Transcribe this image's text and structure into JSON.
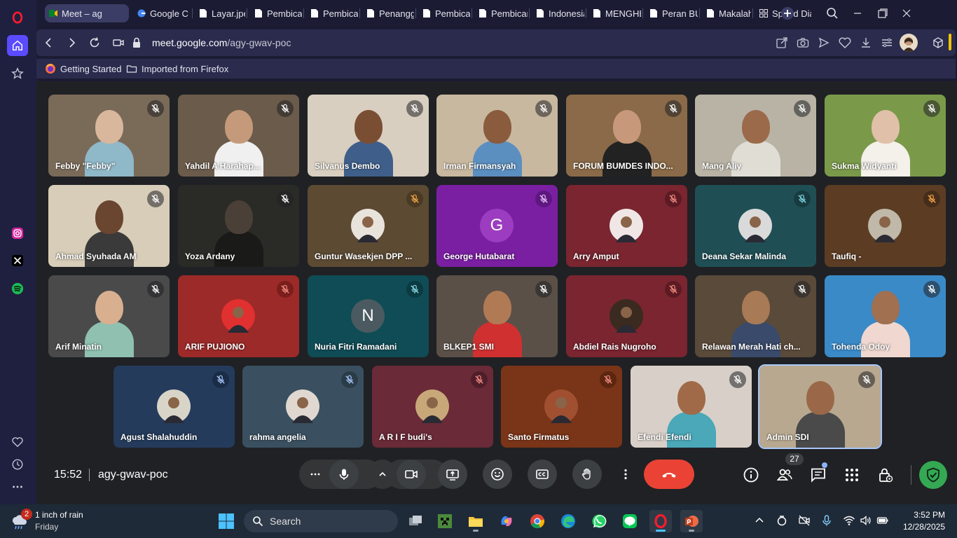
{
  "browser": {
    "tabs": [
      {
        "label": "Meet – ag",
        "active": true
      },
      {
        "label": "Google C"
      },
      {
        "label": "Layar.jpeg"
      },
      {
        "label": "Pembicara"
      },
      {
        "label": "Pembicara"
      },
      {
        "label": "Penangga"
      },
      {
        "label": "Pembicar"
      },
      {
        "label": "Pembicar"
      },
      {
        "label": "Indonesia"
      },
      {
        "label": "MENGHE"
      },
      {
        "label": "Peran BU"
      },
      {
        "label": "Makalah"
      },
      {
        "label": "Speed Dia"
      }
    ],
    "url_host": "meet.google.com",
    "url_path": "/agy-gwav-poc",
    "bookmarks": [
      "Getting Started",
      "Imported from Firefox"
    ]
  },
  "meet": {
    "participants": [
      {
        "name": "Febby \"Febby\"",
        "kind": "video",
        "bg": "#7a6a58",
        "skin": "#d8b79c",
        "shirt": "#8fb8c8"
      },
      {
        "name": "Yahdil A Harahap...",
        "kind": "video",
        "bg": "#6b5b4b",
        "skin": "#c59a7a",
        "shirt": "#f0f0f0"
      },
      {
        "name": "Silvanus Dembo",
        "kind": "video",
        "bg": "#d9cfc0",
        "skin": "#7a4e33",
        "shirt": "#3f5f8a"
      },
      {
        "name": "Irman Firmansyah",
        "kind": "video",
        "bg": "#c8b8a0",
        "skin": "#8a5b3c",
        "shirt": "#5b8fc0"
      },
      {
        "name": "FORUM BUMDES INDO...",
        "kind": "video",
        "bg": "#8a6a48",
        "skin": "#c8987a",
        "shirt": "#222222"
      },
      {
        "name": "Mang Aliy",
        "kind": "video",
        "bg": "#b9b3a5",
        "skin": "#9a6a4a",
        "shirt": "#e0ddd5"
      },
      {
        "name": "Sukma Widyanti",
        "kind": "video",
        "bg": "#7a9a4a",
        "skin": "#e0c0a8",
        "shirt": "#f4f0ea"
      },
      {
        "name": "Ahmad Syuhada AM",
        "kind": "video",
        "bg": "#d8cdb8",
        "skin": "#6a4530",
        "shirt": "#3a3a3a"
      },
      {
        "name": "Yoza Ardany",
        "kind": "video",
        "bg": "#2a2a26",
        "skin": "#4a4038",
        "shirt": "#1a1a18"
      },
      {
        "name": "Guntur Wasekjen DPP ...",
        "kind": "avatar",
        "bg": "#5c4a33",
        "avatar_bg": "#e8e4dc",
        "mic_bg": "#4a3a24",
        "mic_color": "#f2a546"
      },
      {
        "name": "George Hutabarat",
        "kind": "letter",
        "letter": "G",
        "bg": "#7b1fa2",
        "avatar_bg": "#9c3cc0",
        "mic_bg": "#5e1780",
        "mic_color": "#e6c0f5"
      },
      {
        "name": "Arry Amput",
        "kind": "avatar",
        "bg": "#7a2530",
        "avatar_bg": "#f0e6e6",
        "mic_bg": "#5c1a22",
        "mic_color": "#f28b82"
      },
      {
        "name": "Deana Sekar Malinda",
        "kind": "avatar",
        "bg": "#1f4f55",
        "avatar_bg": "#dadada",
        "mic_bg": "#173b40",
        "mic_color": "#7fd8e0"
      },
      {
        "name": "Taufiq -",
        "kind": "avatar",
        "bg": "#5c3d24",
        "avatar_bg": "#c0b8a8",
        "mic_bg": "#452d1a",
        "mic_color": "#f2a546"
      },
      {
        "name": "Arif Minatin",
        "kind": "video",
        "bg": "#4a4a4a",
        "skin": "#d8b090",
        "shirt": "#8fc0b0"
      },
      {
        "name": "ARIF PUJIONO",
        "kind": "avatar",
        "bg": "#9c2a28",
        "avatar_bg": "#e03030",
        "mic_bg": "#7a1e1c",
        "mic_color": "#f28b82"
      },
      {
        "name": "Nuria Fitri Ramadani",
        "kind": "letter",
        "letter": "N",
        "bg": "#0f4c55",
        "avatar_bg": "#4a5a60",
        "mic_bg": "#0b3a41",
        "mic_color": "#8ad8e8"
      },
      {
        "name": "BLKEP1 SMI",
        "kind": "video",
        "bg": "#5a5048",
        "skin": "#b07a55",
        "shirt": "#d03030"
      },
      {
        "name": "Abdiel Rais Nugroho",
        "kind": "avatar",
        "bg": "#7a2530",
        "avatar_bg": "#3a2a20",
        "mic_bg": "#5c1a22",
        "mic_color": "#f28b82"
      },
      {
        "name": "Relawan Merah Hati ch...",
        "kind": "video",
        "bg": "#5a4a3a",
        "skin": "#a87a55",
        "shirt": "#3a4a6a"
      },
      {
        "name": "Tohenda Odoy",
        "kind": "video",
        "bg": "#3a8ac8",
        "skin": "#a07050",
        "shirt": "#f0d8d0"
      },
      {
        "name": "Agust Shalahuddin",
        "kind": "avatar",
        "bg": "#243b5c",
        "avatar_bg": "#d8d4c8",
        "mic_bg": "#1a2c46",
        "mic_color": "#a8c7fa"
      },
      {
        "name": "rahma angelia",
        "kind": "avatar",
        "bg": "#3a5060",
        "avatar_bg": "#e0d8d0",
        "mic_bg": "#2a3c48",
        "mic_color": "#a8c7fa"
      },
      {
        "name": "A R I F budi's",
        "kind": "avatar",
        "bg": "#6a2a38",
        "avatar_bg": "#c8a878",
        "mic_bg": "#4f1e2a",
        "mic_color": "#f28b82"
      },
      {
        "name": "Santo Firmatus",
        "kind": "avatar",
        "bg": "#7a3418",
        "avatar_bg": "#a05030",
        "mic_bg": "#5c2610",
        "mic_color": "#f28b82"
      },
      {
        "name": "Efendi Efendi",
        "kind": "video",
        "bg": "#d8d0c8",
        "skin": "#a06a48",
        "shirt": "#4aa8b8"
      },
      {
        "name": "Admin SDI",
        "kind": "video",
        "bg": "#b8a890",
        "skin": "#9a6848",
        "shirt": "#4a4a4a",
        "selected": true
      }
    ],
    "time": "15:52",
    "meeting_code": "agy-gwav-poc",
    "people_count": "27"
  },
  "taskbar": {
    "weather_badge": "2",
    "weather_line1": "1 inch of rain",
    "weather_line2": "Friday",
    "search_label": "Search",
    "clock_time": "3:52 PM",
    "clock_date": "12/28/2025"
  },
  "colors": {
    "meet_bg": "#202124",
    "end_call": "#ea4335",
    "opera_red": "#ff1b2d",
    "sidebar_accent": "#5b4bff"
  }
}
